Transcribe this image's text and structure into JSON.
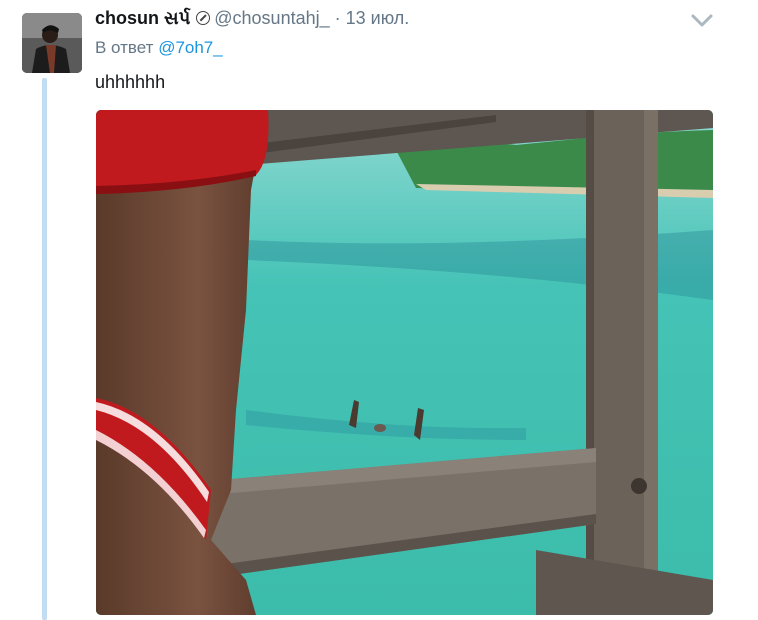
{
  "tweet": {
    "author_name": "chosun સર્પ",
    "author_handle": "@chosuntahj_",
    "separator": "·",
    "time": "13 июл.",
    "reply_prefix": "В ответ",
    "reply_to": "@7oh7_",
    "text": "uhhhhhh"
  },
  "colors": {
    "link": "#1b95e0",
    "muted": "#657786",
    "thread_line": "#c2ddf1"
  },
  "icons": {
    "protected": "protected-icon",
    "caret": "chevron-down-icon"
  }
}
